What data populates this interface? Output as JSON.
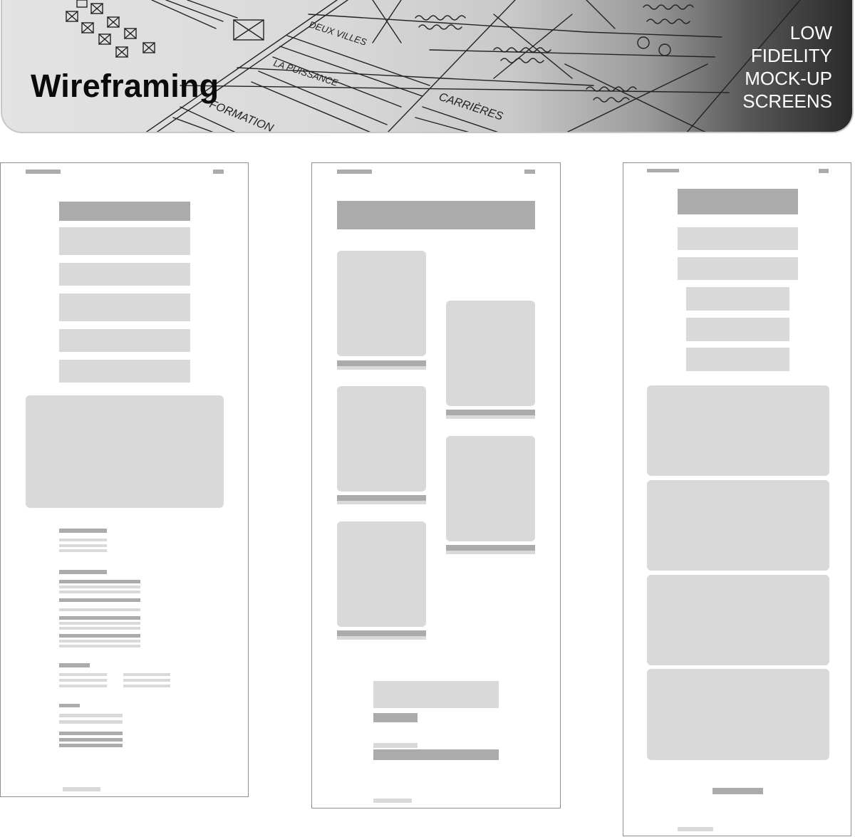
{
  "banner": {
    "title": "Wireframing",
    "subtitle_lines": [
      "LOW",
      "FIDELITY",
      "MOCK-UP",
      "SCREENS"
    ],
    "sketch_words": [
      "DEUX VILLES",
      "LA PUISSANCE",
      "FORMATION",
      "CARRIÈRES"
    ]
  },
  "colors": {
    "placeholder_dark": "#ababab",
    "placeholder_light": "#d9d9d9",
    "screen_border": "#8e8e8e",
    "title_text": "#0b0b0b",
    "subtitle_text": "#ffffff"
  },
  "screens": [
    "screen-1",
    "screen-2",
    "screen-3"
  ]
}
